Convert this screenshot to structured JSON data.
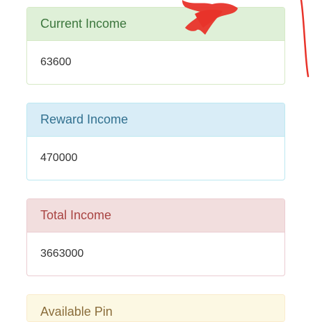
{
  "panels": [
    {
      "title": "Current Income",
      "value": "63600"
    },
    {
      "title": "Reward Income",
      "value": "470000"
    },
    {
      "title": "Total Income",
      "value": "3663000"
    },
    {
      "title": "Available Pin",
      "value": ""
    }
  ],
  "colors": {
    "success_bg": "#dff0d8",
    "success_text": "#3c763d",
    "info_bg": "#d9edf7",
    "info_text": "#31708f",
    "danger_bg": "#f2dede",
    "danger_text": "#a94442",
    "warning_bg": "#fcf8e3",
    "warning_text": "#8a6d3b",
    "annotation_red": "#e8332a"
  }
}
